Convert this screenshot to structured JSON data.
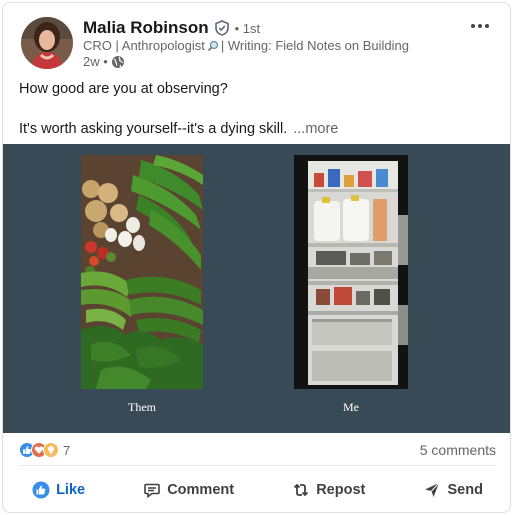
{
  "author": {
    "name": "Malia Robinson",
    "degree": "• 1st",
    "headline_start": "CRO | Anthropologist",
    "headline_end": "| Writing: Field Notes on Building",
    "time": "2w •",
    "verified_icon": "verified-shield-icon",
    "visibility_icon": "globe-icon"
  },
  "post": {
    "line1": "How good are you at observing?",
    "line2": "It's worth asking yourself--it's a dying skill.",
    "see_more": "...more"
  },
  "media": {
    "left_caption": "Them",
    "right_caption": "Me",
    "background": "#374a55"
  },
  "social": {
    "reaction_count": "7",
    "comments": "5 comments",
    "reaction_icons": [
      "like-reaction-icon",
      "love-reaction-icon",
      "insightful-reaction-icon"
    ]
  },
  "actions": {
    "like": "Like",
    "comment": "Comment",
    "repost": "Repost",
    "send": "Send"
  },
  "colors": {
    "accent": "#0a66c2",
    "text": "#191919",
    "muted": "#666666"
  }
}
